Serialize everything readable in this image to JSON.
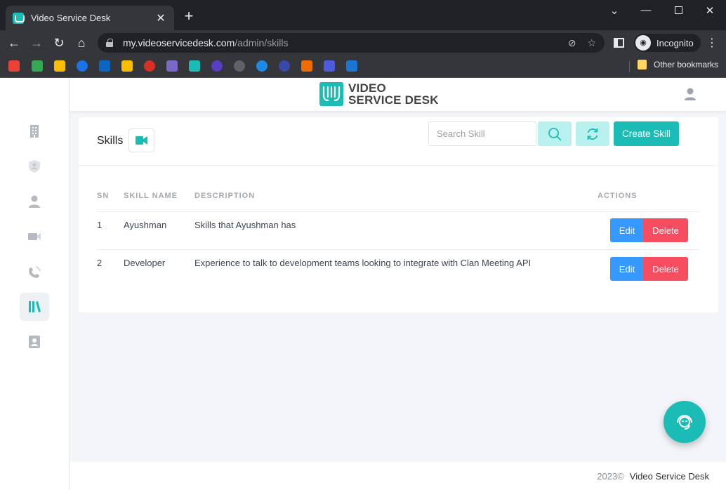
{
  "browser": {
    "tab_title": "Video Service Desk",
    "url_host": "my.videoservicedesk.com",
    "url_path": "/admin/skills",
    "profile_label": "Incognito",
    "other_bookmarks": "Other bookmarks",
    "bookmark_icons": [
      "gmail-icon",
      "google-meet-icon",
      "google-drive-icon",
      "tasks-icon",
      "linkedin-icon",
      "keep-icon",
      "app-icon",
      "videoservicedesk-icon",
      "videoservicedesk-icon",
      "canva-icon",
      "app-icon",
      "app-icon",
      "app-icon",
      "app-icon",
      "miro-icon",
      "app-icon"
    ]
  },
  "header": {
    "logo_line1": "VIDEO",
    "logo_line2": "SERVICE DESK"
  },
  "skills": {
    "title": "Skills",
    "search_placeholder": "Search Skill",
    "create_label": "Create Skill",
    "columns": {
      "sn": "SN",
      "name": "SKILL NAME",
      "description": "DESCRIPTION",
      "actions": "ACTIONS"
    },
    "rows": [
      {
        "sn": "1",
        "name": "Ayushman",
        "description": "Skills that Ayushman has",
        "edit": "Edit",
        "delete": "Delete"
      },
      {
        "sn": "2",
        "name": "Developer",
        "description": "Experience to talk to development teams looking to integrate with Clan Meeting API",
        "edit": "Edit",
        "delete": "Delete"
      }
    ]
  },
  "footer": {
    "year": "2023©",
    "brand": "Video Service Desk"
  },
  "colors": {
    "accent": "#1bbcb5",
    "edit": "#3699ff",
    "delete": "#f64e60"
  }
}
